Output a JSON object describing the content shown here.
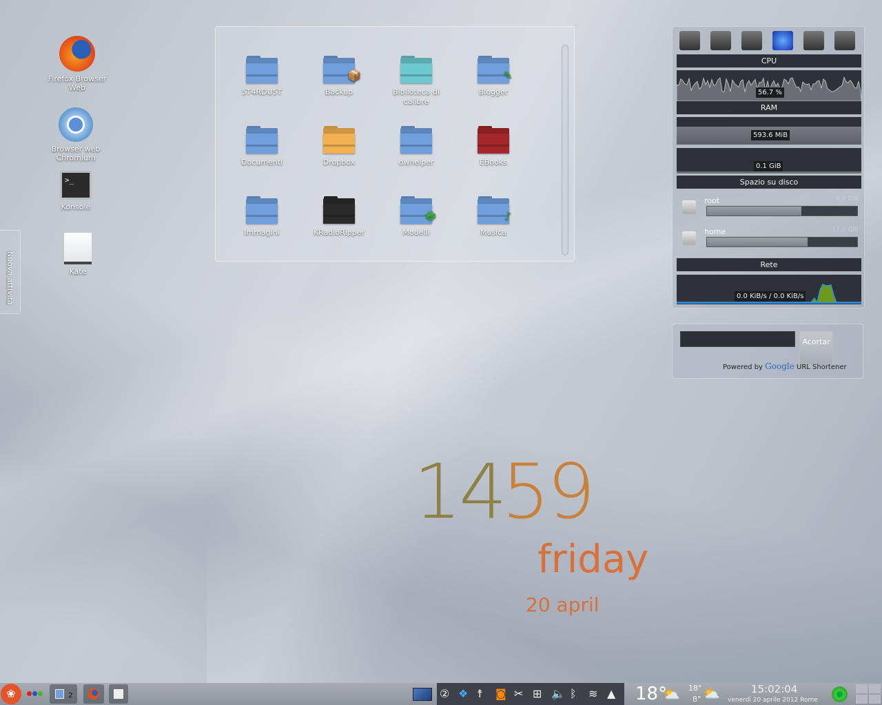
{
  "desktop_icons": [
    {
      "label": "Firefox Browser Web",
      "icon": "firefox-icon"
    },
    {
      "label": "Browser web Chromium",
      "icon": "chromium-icon"
    },
    {
      "label": "Konsole",
      "icon": "terminal-icon"
    },
    {
      "label": "Kate",
      "icon": "text-editor-icon"
    }
  ],
  "activity_tab": {
    "label": "Nuova attività"
  },
  "folder_view": {
    "items": [
      {
        "label": "5T4RDU5T",
        "color": "#6f9fdc"
      },
      {
        "label": "Backup",
        "color": "#6f9fdc",
        "emblem": "package-icon"
      },
      {
        "label": "Biblioteca di calibre",
        "color": "#6cc9cf"
      },
      {
        "label": "Blogger",
        "color": "#6f9fdc",
        "emblem": "pencil-icon"
      },
      {
        "label": "Documenti",
        "color": "#6f9fdc",
        "emblem": "documents-icon"
      },
      {
        "label": "Dropbox",
        "color": "#f2b150"
      },
      {
        "label": "dwhelper",
        "color": "#6f9fdc"
      },
      {
        "label": "EBooks",
        "color": "#a3262a"
      },
      {
        "label": "Immagini",
        "color": "#6f9fdc",
        "emblem": "pictures-icon"
      },
      {
        "label": "KRadioRipper",
        "color": "#2a2a2a"
      },
      {
        "label": "Modelli",
        "color": "#6f9fdc",
        "emblem": "printer-icon"
      },
      {
        "label": "Musica",
        "color": "#6f9fdc",
        "emblem": "music-note-icon"
      }
    ]
  },
  "system_monitor": {
    "tabs": [
      "cpu-chip-icon",
      "hard-disk-icon",
      "hardware-icon",
      "network-globe-icon",
      "memory-chip-icon",
      "signal-bars-icon"
    ],
    "cpu": {
      "title": "CPU",
      "value": "56.7 %"
    },
    "ram": {
      "title": "RAM",
      "value": "593.6 MiB",
      "swap": "0.1 GiB"
    },
    "disk": {
      "title": "Spazio su disco",
      "items": [
        {
          "name": "root",
          "size": "6,8 GiB",
          "used_percent": 63
        },
        {
          "name": "home",
          "size": "17,3 GiB",
          "used_percent": 67
        }
      ]
    },
    "network": {
      "title": "Rete",
      "value": "0.0 KiB/s / 0.0 KiB/s"
    }
  },
  "url_shortener": {
    "input_value": "",
    "button": "Acortar",
    "powered_prefix": "Powered by",
    "brand": "Google",
    "suffix": "URL Shortener"
  },
  "clock": {
    "hours": "14",
    "minutes": "59",
    "weekday": "friday",
    "date": "20 april"
  },
  "taskbar": {
    "pager_number": "2",
    "weather_temp": "18°",
    "forecast_high": "18°",
    "forecast_low": "8°",
    "time": "15:02:04",
    "date": "venerdì 20 aprile 2012 Rome",
    "tray_icons": [
      "klipper-icon",
      "dropbox-icon",
      "accessibility-icon",
      "feed-icon",
      "scissors-icon",
      "network-icon",
      "volume-icon",
      "bluetooth-icon",
      "wifi-icon",
      "expand-tray-icon"
    ]
  },
  "colors": {
    "clock_orange": "#d9703a",
    "clock_olive": "#8a7a3a",
    "folder_blue": "#6f9fdc"
  }
}
